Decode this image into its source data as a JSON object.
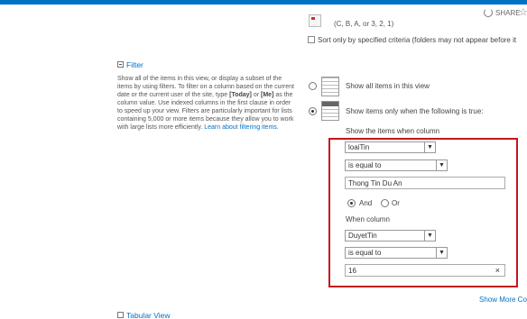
{
  "header": {
    "share_label": "SHARE",
    "star_icon": "☆"
  },
  "sort": {
    "order_example": "(C, B, A, or 3, 2, 1)",
    "only_specified_label": "Sort only by specified criteria (folders may not appear before it"
  },
  "filter_section": {
    "title": "Filter",
    "desc_1": "Show all of the items in this view, or display a subset of the items by using filters. To filter on a column based on the current date or the current user of the site, type ",
    "today": "[Today]",
    "desc_or": " or ",
    "me": "[Me]",
    "desc_2": " as the column value. Use indexed columns in the first clause in order to speed up your view. Filters are particularly important for lists containing 5,000 or more items because they allow you to work with large lists more efficiently. ",
    "link": "Learn about filtering items.",
    "show_all_label": "Show all items in this view",
    "show_only_label": "Show items only when the following is true:",
    "show_when_label": "Show the items when column",
    "column1": "loaiTin",
    "operator1": "is equal to",
    "value1": "Thong Tin Du An",
    "and_label": "And",
    "or_label": "Or",
    "when_column_label": "When column",
    "column2": "DuyetTin",
    "operator2": "is equal to",
    "value2": "16",
    "clear_icon": "×",
    "show_more": "Show More Co"
  },
  "tabular_section": {
    "title": "Tabular View"
  }
}
